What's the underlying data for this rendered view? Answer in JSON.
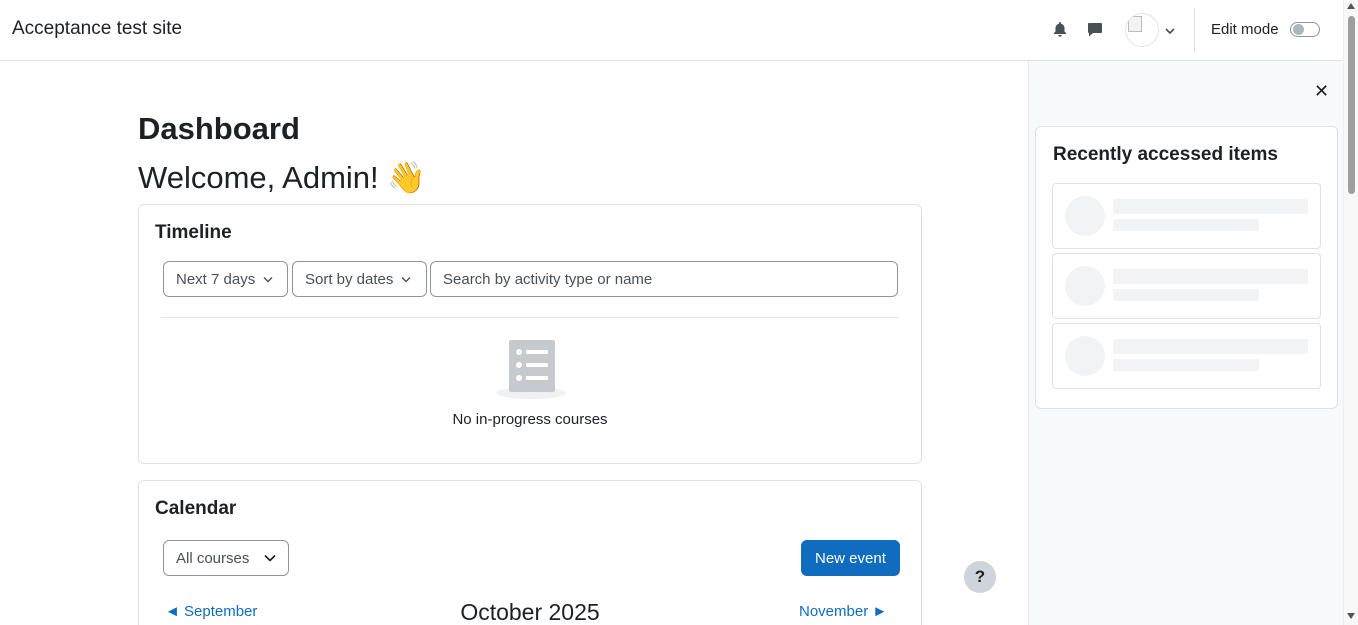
{
  "header": {
    "site_name": "Acceptance test site",
    "notification_icon": "bell-icon",
    "messages_icon": "chat-bubble-icon",
    "user_menu_icon": "chevron-down-icon",
    "edit_mode_label": "Edit mode",
    "edit_mode_on": false
  },
  "main": {
    "title": "Dashboard",
    "welcome": "Welcome, Admin! 👋"
  },
  "timeline": {
    "title": "Timeline",
    "filter_label": "Next 7 days",
    "sort_label": "Sort by dates",
    "search_placeholder": "Search by activity type or name",
    "empty_text": "No in-progress courses"
  },
  "calendar": {
    "title": "Calendar",
    "course_filter": "All courses",
    "new_event_label": "New event",
    "prev_month": "◄  September",
    "current_month": "October 2025",
    "next_month": "November  ►"
  },
  "drawer": {
    "close_icon": "close-icon",
    "recently_accessed_title": "Recently accessed items",
    "placeholder_count": 3
  },
  "help": {
    "label": "?"
  },
  "colors": {
    "primary": "#0f6cbf",
    "drawer_bg": "#f8f9fa",
    "border": "#dee2e6",
    "text": "#1d2125"
  }
}
